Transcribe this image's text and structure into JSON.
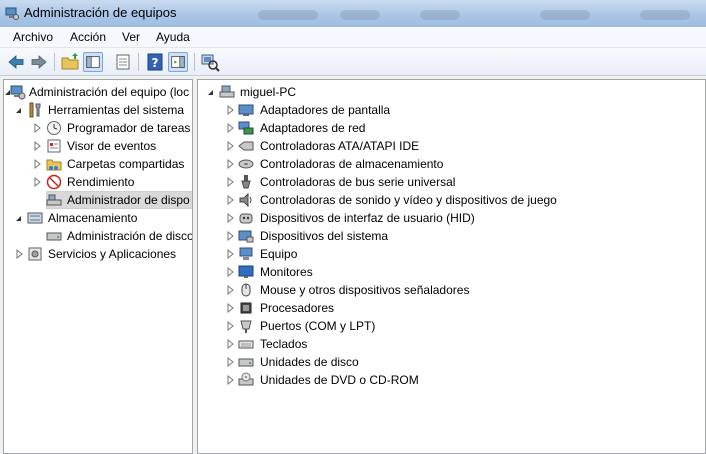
{
  "window": {
    "title": "Administración de equipos"
  },
  "menu": {
    "items": [
      "Archivo",
      "Acción",
      "Ver",
      "Ayuda"
    ]
  },
  "toolbar": {
    "buttons": [
      "back-icon",
      "forward-icon",
      "up-folder-icon",
      "show-hide-tree-icon",
      "properties-icon",
      "help-icon",
      "action-pane-icon",
      "scan-hardware-icon"
    ]
  },
  "left_tree": {
    "root": "Administración del equipo (loc",
    "system_tools": "Herramientas del sistema",
    "task_scheduler": "Programador de tareas",
    "event_viewer": "Visor de eventos",
    "shared_folders": "Carpetas compartidas",
    "performance": "Rendimiento",
    "device_manager": "Administrador de dispo",
    "storage": "Almacenamiento",
    "disk_management": "Administración de disco",
    "services": "Servicios y Aplicaciones"
  },
  "device_tree": {
    "computer": "miguel-PC",
    "categories": [
      "Adaptadores de pantalla",
      "Adaptadores de red",
      "Controladoras ATA/ATAPI IDE",
      "Controladoras de almacenamiento",
      "Controladoras de bus serie universal",
      "Controladoras de sonido y vídeo y dispositivos de juego",
      "Dispositivos de interfaz de usuario (HID)",
      "Dispositivos del sistema",
      "Equipo",
      "Monitores",
      "Mouse y otros dispositivos señaladores",
      "Procesadores",
      "Puertos (COM y LPT)",
      "Teclados",
      "Unidades de disco",
      "Unidades de DVD o CD-ROM"
    ]
  },
  "colors": {
    "accent": "#3c7fb1",
    "selection": "#d9d9d9",
    "titlebar": "#aac6e6"
  }
}
